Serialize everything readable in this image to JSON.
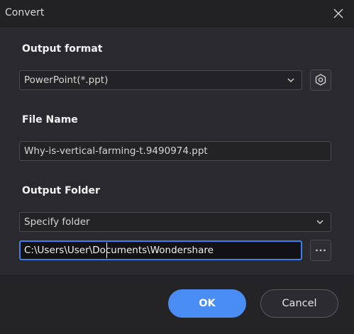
{
  "dialog": {
    "title": "Convert"
  },
  "output_format": {
    "label": "Output format",
    "selected": "PowerPoint(*.ppt)",
    "settings_icon": "hexagon-settings-icon"
  },
  "file_name": {
    "label": "File Name",
    "value": "Why-is-vertical-farming-t.9490974.ppt"
  },
  "output_folder": {
    "label": "Output Folder",
    "selected": "Specify folder",
    "path": "C:\\Users\\User\\Documents\\Wondershare",
    "browse_icon": "ellipsis-icon"
  },
  "buttons": {
    "ok": "OK",
    "cancel": "Cancel"
  },
  "colors": {
    "accent": "#4a8ef5",
    "focus_border": "#3b7ef0",
    "background": "#2a2a2e"
  }
}
